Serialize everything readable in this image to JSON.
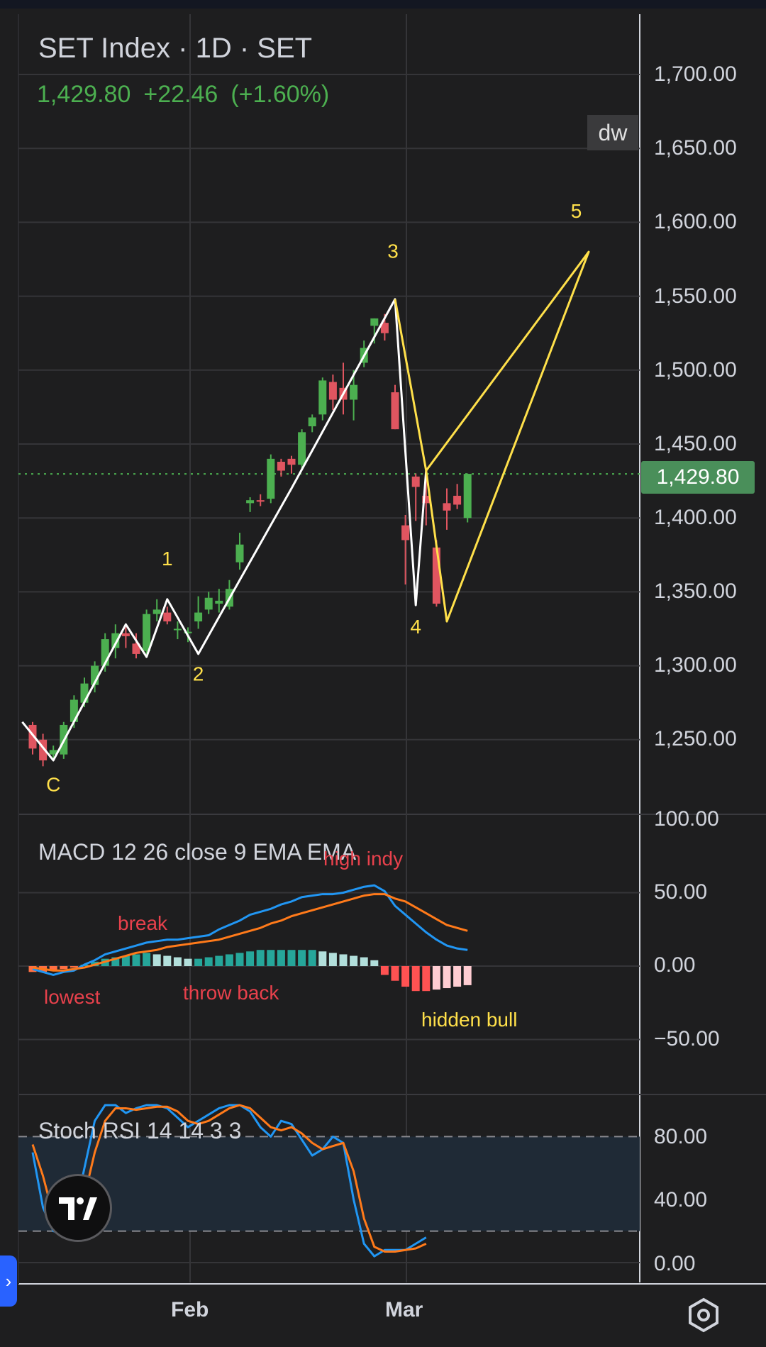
{
  "header": {
    "title": "SET Index · 1D · SET",
    "last_price": "1,429.80",
    "change": "+22.46",
    "change_pct": "(+1.60%)",
    "dw_label": "dw",
    "last_price_label": "1,429.80"
  },
  "colors": {
    "up": "#4caf50",
    "down": "#e05560",
    "wave_white": "#ffffff",
    "wave_yellow": "#ffe04a",
    "macd_line": "#2196f3",
    "signal_line": "#ff7a1a",
    "annotation_red": "#e8414c",
    "annotation_yellow": "#ffe04a"
  },
  "chart_data": [
    {
      "type": "candlestick",
      "title": "SET Index · 1D · SET",
      "ylim": [
        1210,
        1725
      ],
      "y_ticks": [
        "1,700.00",
        "1,650.00",
        "1,600.00",
        "1,550.00",
        "1,500.00",
        "1,450.00",
        "1,400.00",
        "1,350.00",
        "1,300.00",
        "1,250.00"
      ],
      "x_ticks": [
        "Feb",
        "Mar"
      ],
      "last_price": 1429.8,
      "candles": [
        {
          "o": 1260,
          "h": 1262,
          "l": 1240,
          "c": 1244
        },
        {
          "o": 1250,
          "h": 1254,
          "l": 1232,
          "c": 1236
        },
        {
          "o": 1240,
          "h": 1246,
          "l": 1236,
          "c": 1243
        },
        {
          "o": 1240,
          "h": 1262,
          "l": 1237,
          "c": 1260
        },
        {
          "o": 1262,
          "h": 1280,
          "l": 1258,
          "c": 1277
        },
        {
          "o": 1275,
          "h": 1292,
          "l": 1272,
          "c": 1288
        },
        {
          "o": 1287,
          "h": 1303,
          "l": 1282,
          "c": 1300
        },
        {
          "o": 1300,
          "h": 1322,
          "l": 1296,
          "c": 1318
        },
        {
          "o": 1312,
          "h": 1328,
          "l": 1305,
          "c": 1322
        },
        {
          "o": 1322,
          "h": 1326,
          "l": 1312,
          "c": 1320
        },
        {
          "o": 1315,
          "h": 1322,
          "l": 1305,
          "c": 1308
        },
        {
          "o": 1310,
          "h": 1338,
          "l": 1308,
          "c": 1335
        },
        {
          "o": 1335,
          "h": 1345,
          "l": 1330,
          "c": 1338
        },
        {
          "o": 1336,
          "h": 1340,
          "l": 1328,
          "c": 1330
        },
        {
          "o": 1325,
          "h": 1330,
          "l": 1318,
          "c": 1325
        },
        {
          "o": 1322,
          "h": 1326,
          "l": 1316,
          "c": 1323
        },
        {
          "o": 1330,
          "h": 1347,
          "l": 1325,
          "c": 1336
        },
        {
          "o": 1338,
          "h": 1350,
          "l": 1335,
          "c": 1346
        },
        {
          "o": 1342,
          "h": 1352,
          "l": 1336,
          "c": 1344
        },
        {
          "o": 1340,
          "h": 1358,
          "l": 1338,
          "c": 1352
        },
        {
          "o": 1370,
          "h": 1390,
          "l": 1365,
          "c": 1382
        },
        {
          "o": 1410,
          "h": 1414,
          "l": 1404,
          "c": 1412
        },
        {
          "o": 1412,
          "h": 1416,
          "l": 1408,
          "c": 1411
        },
        {
          "o": 1413,
          "h": 1443,
          "l": 1410,
          "c": 1440
        },
        {
          "o": 1438,
          "h": 1440,
          "l": 1428,
          "c": 1432
        },
        {
          "o": 1440,
          "h": 1442,
          "l": 1430,
          "c": 1436
        },
        {
          "o": 1436,
          "h": 1460,
          "l": 1433,
          "c": 1458
        },
        {
          "o": 1462,
          "h": 1470,
          "l": 1458,
          "c": 1468
        },
        {
          "o": 1470,
          "h": 1495,
          "l": 1466,
          "c": 1493
        },
        {
          "o": 1492,
          "h": 1497,
          "l": 1473,
          "c": 1480
        },
        {
          "o": 1488,
          "h": 1505,
          "l": 1470,
          "c": 1480
        },
        {
          "o": 1480,
          "h": 1500,
          "l": 1466,
          "c": 1490
        },
        {
          "o": 1505,
          "h": 1520,
          "l": 1502,
          "c": 1515
        },
        {
          "o": 1530,
          "h": 1535,
          "l": 1518,
          "c": 1535
        },
        {
          "o": 1532,
          "h": 1538,
          "l": 1520,
          "c": 1525
        },
        {
          "o": 1485,
          "h": 1490,
          "l": 1460,
          "c": 1460
        },
        {
          "o": 1395,
          "h": 1402,
          "l": 1355,
          "c": 1385
        },
        {
          "o": 1428,
          "h": 1430,
          "l": 1398,
          "c": 1421
        },
        {
          "o": 1415,
          "h": 1430,
          "l": 1395,
          "c": 1410
        },
        {
          "o": 1380,
          "h": 1385,
          "l": 1340,
          "c": 1342
        },
        {
          "o": 1410,
          "h": 1420,
          "l": 1392,
          "c": 1405
        },
        {
          "o": 1415,
          "h": 1423,
          "l": 1406,
          "c": 1409
        },
        {
          "o": 1400,
          "h": 1430,
          "l": 1397,
          "c": 1429.8
        }
      ],
      "wave_white": [
        {
          "i": -1,
          "v": 1262
        },
        {
          "i": 2,
          "v": 1236
        },
        {
          "i": 9,
          "v": 1328
        },
        {
          "i": 11,
          "v": 1306
        },
        {
          "i": 13,
          "v": 1345
        },
        {
          "i": 16,
          "v": 1308
        },
        {
          "i": 20,
          "v": 1358
        },
        {
          "i": 25,
          "v": 1420
        },
        {
          "i": 35,
          "v": 1548
        },
        {
          "i": 37,
          "v": 1341
        },
        {
          "i": 38,
          "v": 1432
        }
      ],
      "wave_yellow": [
        {
          "i": 35,
          "v": 1548
        },
        {
          "i": 38,
          "v": 1432
        },
        {
          "i": 53.7,
          "v": 1580
        },
        {
          "i": 40,
          "v": 1330
        },
        {
          "i": 38,
          "v": 1432
        }
      ],
      "labels": [
        {
          "text": "C",
          "i": 2,
          "v": 1215
        },
        {
          "text": "1",
          "i": 13,
          "v": 1368
        },
        {
          "text": "2",
          "i": 16,
          "v": 1290
        },
        {
          "text": "3",
          "i": 34.8,
          "v": 1576
        },
        {
          "text": "4",
          "i": 37,
          "v": 1322
        },
        {
          "text": "5",
          "i": 52.5,
          "v": 1603
        }
      ]
    },
    {
      "type": "line+histogram",
      "title": "MACD 12 26 close 9 EMA EMA",
      "ylim": [
        -80,
        100
      ],
      "y_ticks": [
        "100.00",
        "50.00",
        "0.00",
        "−50.00"
      ],
      "series": [
        {
          "name": "MACD",
          "values": [
            -2,
            -4,
            -6,
            -4,
            -3,
            1,
            4,
            8,
            10,
            12,
            14,
            16,
            17,
            18,
            18,
            19,
            20,
            21,
            25,
            28,
            31,
            35,
            37,
            39,
            42,
            44,
            47,
            48,
            49,
            49,
            50,
            52,
            54,
            55,
            51,
            41,
            35,
            29,
            23,
            18,
            14,
            12,
            11
          ]
        },
        {
          "name": "Signal",
          "values": [
            -1,
            -2,
            -3,
            -3,
            -2,
            -1,
            1,
            3,
            5,
            7,
            9,
            10,
            11,
            13,
            14,
            15,
            16,
            17,
            18,
            20,
            22,
            24,
            26,
            29,
            31,
            34,
            36,
            38,
            40,
            42,
            44,
            46,
            48,
            49,
            49,
            46,
            44,
            40,
            36,
            32,
            28,
            26,
            24
          ]
        },
        {
          "name": "Histogram",
          "values": [
            -4,
            -4,
            -3,
            -2,
            -1,
            1,
            3,
            5,
            6,
            7,
            8,
            9,
            8,
            7,
            6,
            5,
            5,
            6,
            7,
            8,
            9,
            10,
            11,
            11,
            11,
            11,
            11,
            11,
            10,
            9,
            8,
            7,
            6,
            4,
            -6,
            -10,
            -14,
            -17,
            -17,
            -16,
            -15,
            -14,
            -13
          ]
        }
      ],
      "annotations": [
        {
          "text": "high indy",
          "color": "red"
        },
        {
          "text": "break",
          "color": "red"
        },
        {
          "text": "lowest",
          "color": "red"
        },
        {
          "text": "throw back",
          "color": "red"
        },
        {
          "text": "hidden bull",
          "color": "yellow"
        }
      ]
    },
    {
      "type": "line",
      "title": "Stoch RSI 14 14 3 3",
      "ylim": [
        -6,
        108
      ],
      "y_ticks": [
        "80.00",
        "40.00",
        "0.00"
      ],
      "band": [
        20,
        80
      ],
      "series": [
        {
          "name": "K",
          "values": [
            70,
            35,
            20,
            18,
            30,
            60,
            90,
            100,
            100,
            95,
            98,
            100,
            100,
            98,
            92,
            86,
            90,
            94,
            98,
            100,
            100,
            96,
            86,
            80,
            90,
            88,
            78,
            68,
            72,
            80,
            76,
            40,
            12,
            4,
            8,
            8,
            8,
            12,
            16
          ]
        },
        {
          "name": "D",
          "values": [
            75,
            55,
            30,
            20,
            22,
            42,
            70,
            90,
            98,
            98,
            97,
            98,
            99,
            99,
            96,
            90,
            88,
            90,
            94,
            98,
            100,
            98,
            92,
            86,
            84,
            86,
            82,
            76,
            72,
            74,
            76,
            58,
            28,
            10,
            7,
            7,
            8,
            9,
            12
          ]
        }
      ]
    }
  ],
  "macd_labels": {
    "high_indy": "high indy",
    "break": "break",
    "lowest": "lowest",
    "throw_back": "throw back",
    "hidden_bull": "hidden bull"
  },
  "panes": {
    "macd_title": "MACD 12 26 close 9 EMA EMA",
    "stoch_title": "Stoch RSI 14 14 3 3"
  },
  "axis": {
    "price": [
      "1,700.00",
      "1,650.00",
      "1,600.00",
      "1,550.00",
      "1,500.00",
      "1,450.00",
      "1,400.00",
      "1,350.00",
      "1,300.00",
      "1,250.00"
    ],
    "macd": [
      "100.00",
      "50.00",
      "0.00",
      "−50.00"
    ],
    "stoch": [
      "80.00",
      "40.00",
      "0.00"
    ],
    "time": [
      "Feb",
      "Mar"
    ]
  },
  "icons": {
    "logo": "tradingview-logo-icon",
    "handle": "chevron-right-icon",
    "settings": "hexagon-settings-icon",
    "handle_glyph": "›"
  }
}
